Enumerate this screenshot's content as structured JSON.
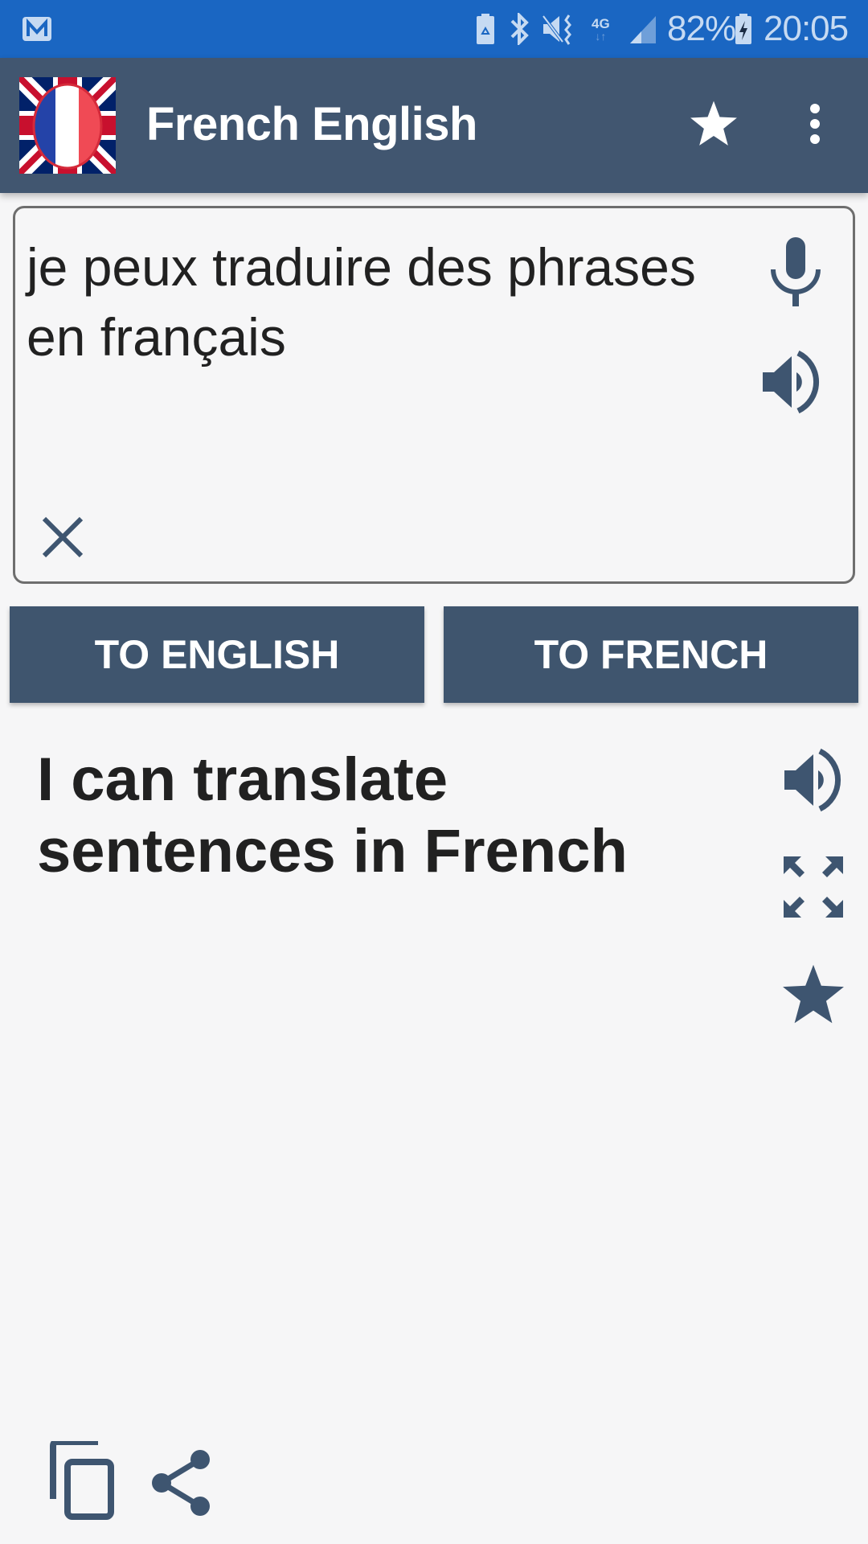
{
  "status_bar": {
    "notification_icons": [
      "mail-icon"
    ],
    "system_icons": [
      "battery-saver-icon",
      "bluetooth-icon",
      "vibrate-mute-icon",
      "4g-data-icon",
      "signal-icon"
    ],
    "network_type": "4G",
    "battery_percent": "82%",
    "time": "20:05"
  },
  "app_bar": {
    "title": "French English",
    "logo": "uk-france-flag",
    "actions": [
      "favorites-star-icon",
      "overflow-menu-icon"
    ]
  },
  "input": {
    "text": "je peux traduire des phrases en français",
    "icons": [
      "microphone-icon",
      "speaker-icon",
      "clear-icon"
    ]
  },
  "buttons": {
    "to_english": "TO ENGLISH",
    "to_french": "TO FRENCH"
  },
  "output": {
    "text": "I can translate sentences in French",
    "icons": [
      "speaker-icon",
      "fullscreen-icon",
      "favorite-star-icon"
    ]
  },
  "bottom_actions": [
    "copy-icon",
    "share-icon"
  ],
  "colors": {
    "status_bar": "#1a66c2",
    "app_bar": "#415670",
    "accent": "#3f556e",
    "icon": "#3e5570",
    "background": "#f6f6f7",
    "text": "#212121"
  }
}
